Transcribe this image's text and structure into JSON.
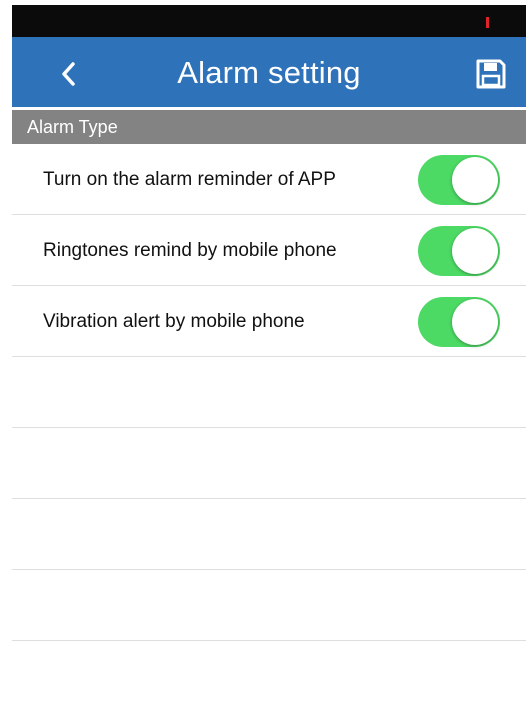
{
  "header": {
    "title": "Alarm setting",
    "back_icon": "chevron-left-icon",
    "save_icon": "floppy-disk-icon"
  },
  "section": {
    "title": "Alarm Type"
  },
  "settings": [
    {
      "label": "Turn on the alarm reminder of APP",
      "enabled": true
    },
    {
      "label": "Ringtones remind by mobile phone",
      "enabled": true
    },
    {
      "label": "Vibration alert by mobile phone",
      "enabled": true
    }
  ],
  "colors": {
    "nav_bar": "#2e72b9",
    "section_header": "#838383",
    "toggle_on": "#4cd964",
    "status_bar": "#0b0b0b",
    "battery": "#e0242a"
  }
}
